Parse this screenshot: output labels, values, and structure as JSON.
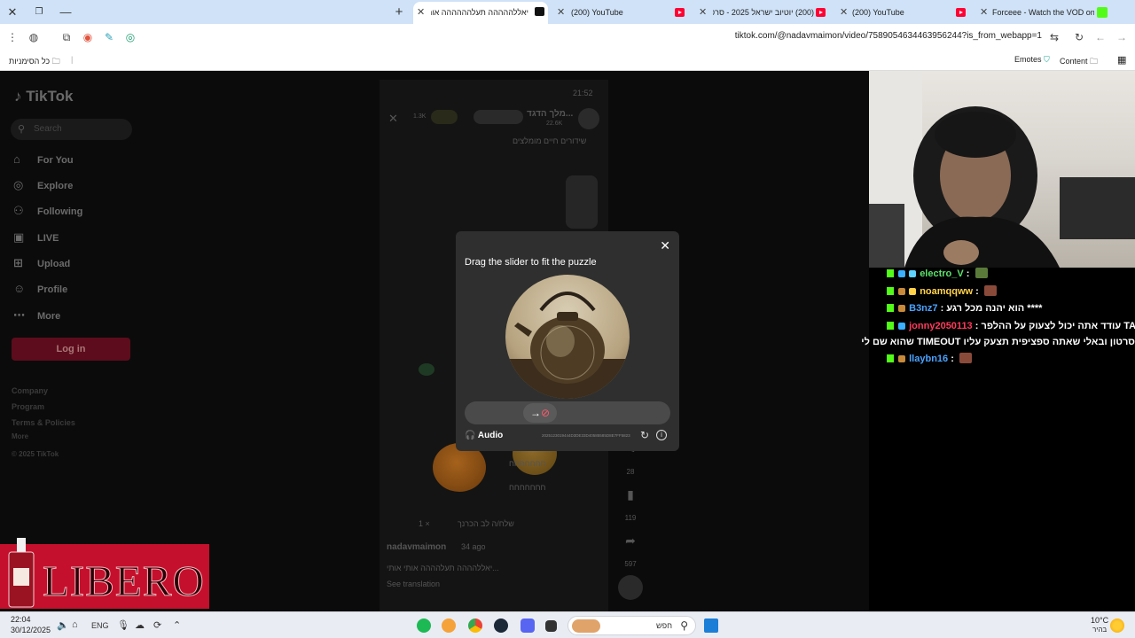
{
  "browser": {
    "tabs": [
      {
        "title": "Forceee - Watch the VOD on K",
        "favicon": "kick-icon"
      },
      {
        "title": "(200) YouTube",
        "favicon": "youtube-icon"
      },
      {
        "title": "(200) יוטיוב ישראל 2025 - סרט",
        "favicon": "youtube-icon"
      },
      {
        "title": "(200) YouTube",
        "favicon": "youtube-icon"
      },
      {
        "title": "יאללההההה תעלהההההה אותי",
        "favicon": "tiktok-icon",
        "active": true
      }
    ],
    "url": "tiktok.com/@nadavmaimon/video/7589054634463956244?is_from_webapp=1",
    "bookmarks_all": "כל הסימניות",
    "bookmark_items": [
      "Content",
      "Emotes"
    ]
  },
  "tiktok": {
    "logo": "TikTok",
    "search_placeholder": "Search",
    "nav": [
      "For You",
      "Explore",
      "Following",
      "LIVE",
      "Upload",
      "Profile",
      "More"
    ],
    "login": "Log in",
    "footer": [
      "Company",
      "Program",
      "Terms & Policies",
      "More",
      "© 2025 TikTok"
    ],
    "video": {
      "status_time": "21:52",
      "live_name": "מלך הדגד...",
      "live_likes": "22.6K",
      "viewers": "1.3K",
      "caption_top": "שידורים חיים מומלצים",
      "comment1": "חחחחחחח",
      "comment2": "חחחחחחח",
      "gift_line": "שלח/ה לב הכרנך",
      "gift_count": "1 ×",
      "author": "nadavmaimon",
      "author_time": "34 ago",
      "description": "יאללהההה תעלהההה אותי אותי...",
      "see_translation": "See translation",
      "side_counts": [
        "28",
        "119",
        "597"
      ]
    }
  },
  "captcha": {
    "title": "Drag the slider to fit the puzzle",
    "audio_label": "Audio",
    "code": "2025123019444D3DE33D40585585D8E7FF5823"
  },
  "chat": [
    {
      "user": "electro_V",
      "color": "#5be36a",
      "message": ""
    },
    {
      "user": "noamqqww",
      "color": "#ffd24a",
      "message": ""
    },
    {
      "user": "B3nz7",
      "color": "#4aa3ff",
      "message": "הוא יהנה מכל רגע ****"
    },
    {
      "user": "jonny2050113",
      "color": "#ff3b5c",
      "message": "עודד אתה יכול לצעוק על ההלפר TAP"
    },
    {
      "user": "",
      "color": "#ffffff",
      "message": "סרטון ובאלי שאתה ספציפית תצעק עליו TIMEOUT שהוא שם לי"
    },
    {
      "user": "llaybn16",
      "color": "#4aa3ff",
      "message": ""
    }
  ],
  "ad": {
    "brand": "LIBERO"
  },
  "taskbar": {
    "time": "22:04",
    "date": "30/12/2025",
    "lang": "ENG",
    "search_label": "חפש",
    "weather_temp": "10°C",
    "weather_desc": "בהיר"
  },
  "colors": {
    "kick_green": "#53fc18",
    "tiktok_red": "#fe2c55",
    "tab_bg": "#cfe2f7"
  }
}
